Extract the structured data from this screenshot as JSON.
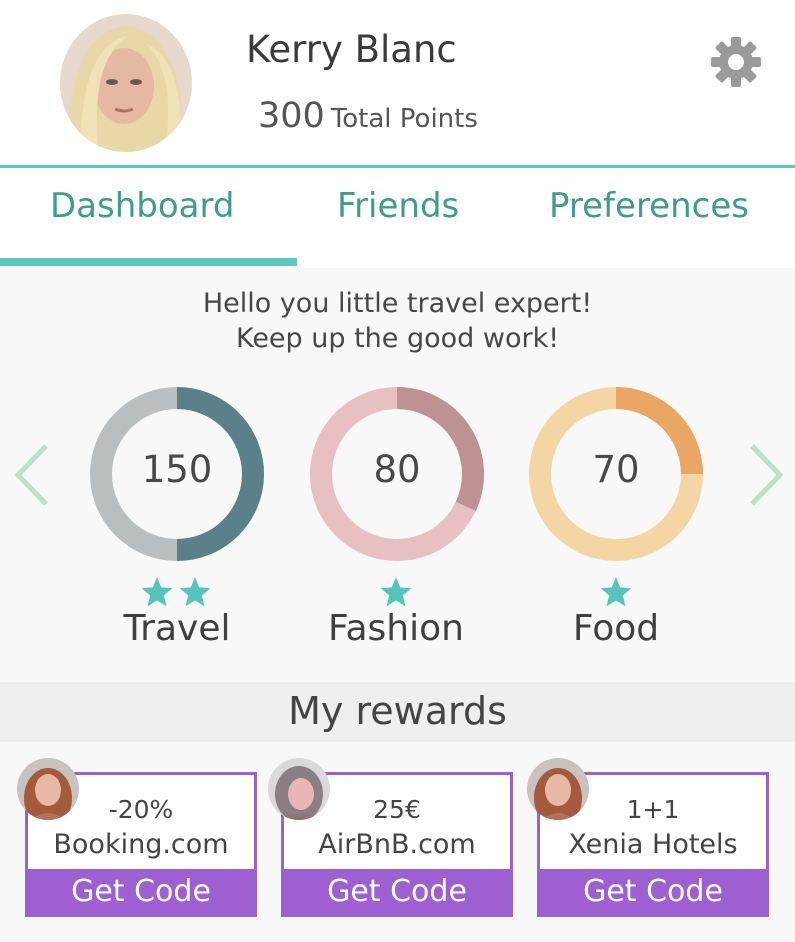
{
  "profile": {
    "name": "Kerry Blanc",
    "points_value": "300",
    "points_label": "Total Points",
    "avatar_icon": "user-avatar"
  },
  "header": {
    "settings_icon": "gear-icon"
  },
  "tabs": [
    {
      "label": "Dashboard",
      "active": true
    },
    {
      "label": "Friends",
      "active": false
    },
    {
      "label": "Preferences",
      "active": false
    }
  ],
  "dashboard": {
    "greeting_line1": "Hello you little travel expert!",
    "greeting_line2": "Keep up the good work!",
    "categories": [
      {
        "label": "Travel",
        "points": "150",
        "stars": 2,
        "progress_fraction": 0.5,
        "track_color": "#b9bfc1",
        "fill_color": "#5a8089"
      },
      {
        "label": "Fashion",
        "points": "80",
        "stars": 1,
        "progress_fraction": 0.32,
        "track_color": "#e8c0c2",
        "fill_color": "#be9192"
      },
      {
        "label": "Food",
        "points": "70",
        "stars": 1,
        "progress_fraction": 0.25,
        "track_color": "#f4d5a4",
        "fill_color": "#eaa763"
      }
    ],
    "prev_icon": "chevron-left-icon",
    "next_icon": "chevron-right-icon"
  },
  "rewards": {
    "title": "My rewards",
    "items": [
      {
        "value": "-20%",
        "partner": "Booking.com",
        "button": "Get Code"
      },
      {
        "value": "25€",
        "partner": "AirBnB.com",
        "button": "Get Code"
      },
      {
        "value": "1+1",
        "partner": "Xenia Hotels",
        "button": "Get Code"
      }
    ]
  },
  "colors": {
    "accent": "#5cc7bc",
    "tab_text": "#3f9b8c",
    "star": "#56c5b9",
    "reward_purple": "#9d5fd1",
    "arrow": "#b8e3c6"
  }
}
